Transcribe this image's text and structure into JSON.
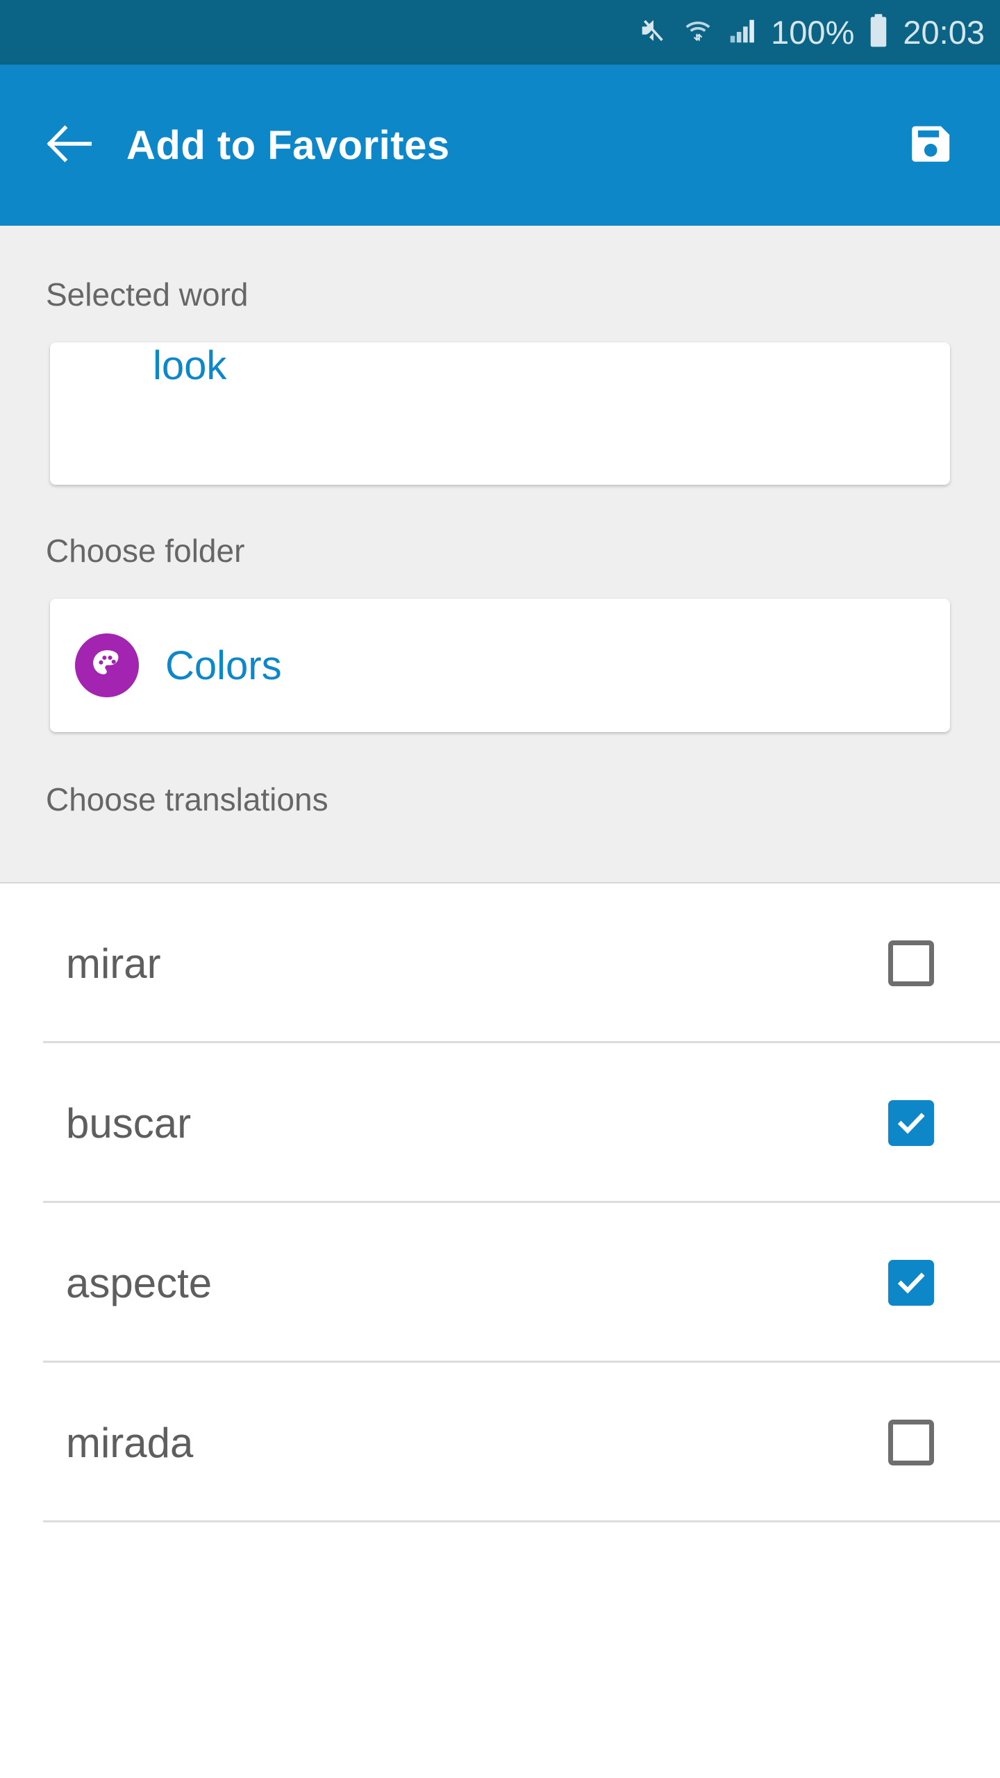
{
  "status_bar": {
    "icons": [
      "mute-icon",
      "wifi-icon",
      "signal-icon",
      "battery-icon"
    ],
    "battery_percent": "100%",
    "time": "20:03",
    "background_color": "#0b6485",
    "foreground_color": "#d6e6ee"
  },
  "app_bar": {
    "back_icon": "back-arrow-icon",
    "title": "Add to Favorites",
    "save_icon": "save-floppy-icon",
    "background_color": "#0d87c8"
  },
  "form": {
    "selected_word_label": "Selected word",
    "selected_word_value": "look",
    "choose_folder_label": "Choose folder",
    "folder_icon": "palette-icon",
    "folder_name": "Colors",
    "folder_icon_color": "#a324b0",
    "choose_translations_label": "Choose translations",
    "accent_color": "#0d87c8",
    "background_color": "#efefef"
  },
  "translations": [
    {
      "label": "mirar",
      "checked": false
    },
    {
      "label": "buscar",
      "checked": true
    },
    {
      "label": "aspecte",
      "checked": true
    },
    {
      "label": "mirada",
      "checked": false
    }
  ]
}
